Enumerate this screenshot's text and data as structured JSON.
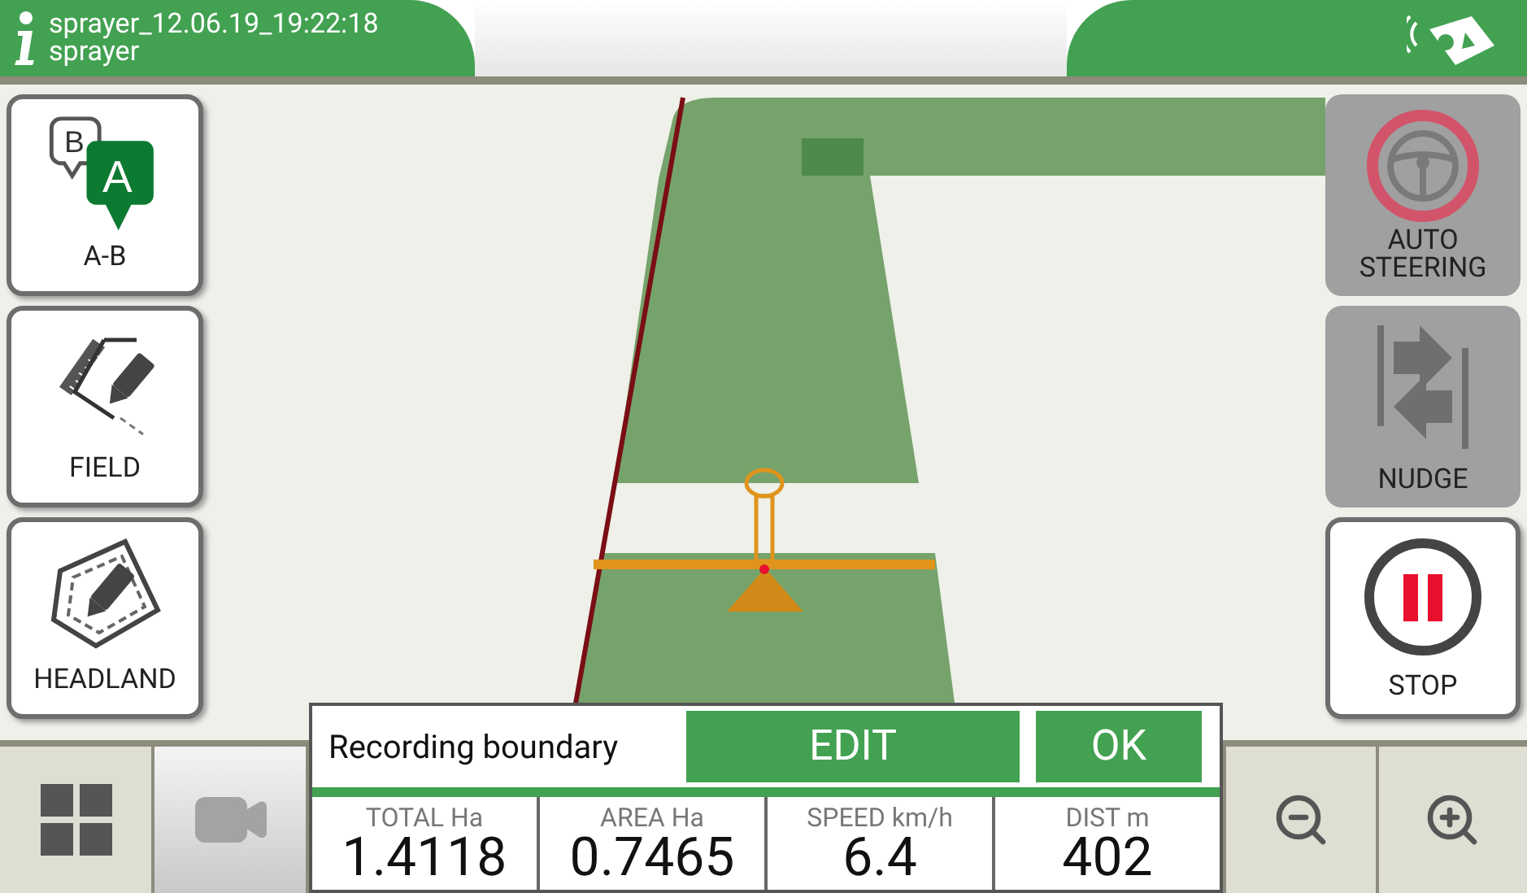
{
  "header": {
    "title": "sprayer_12.06.19_19:22:18",
    "subtitle": "sprayer"
  },
  "left_buttons": [
    {
      "label": "A-B",
      "kind": "ab",
      "marker_b": "B",
      "marker_a": "A"
    },
    {
      "label": "FIELD",
      "kind": "field"
    },
    {
      "label": "HEADLAND",
      "kind": "headland"
    }
  ],
  "right_buttons": [
    {
      "label": "AUTO STEERING",
      "kind": "steering",
      "disabled": true
    },
    {
      "label": "NUDGE",
      "kind": "nudge",
      "disabled": true
    },
    {
      "label": "STOP",
      "kind": "stop",
      "disabled": false
    }
  ],
  "bottom_left_buttons": [
    {
      "kind": "grid",
      "disabled": false
    },
    {
      "kind": "camera",
      "disabled": true
    }
  ],
  "bottom_right_buttons": [
    {
      "kind": "zoom_out"
    },
    {
      "kind": "zoom_in"
    }
  ],
  "dialog": {
    "message": "Recording boundary",
    "buttons": [
      "EDIT",
      "OK"
    ]
  },
  "stats": [
    {
      "label": "TOTAL Ha",
      "value": "1.4118"
    },
    {
      "label": "AREA Ha",
      "value": "0.7465"
    },
    {
      "label": "SPEED km/h",
      "value": "6.4"
    },
    {
      "label": "DIST m",
      "value": "402"
    }
  ]
}
